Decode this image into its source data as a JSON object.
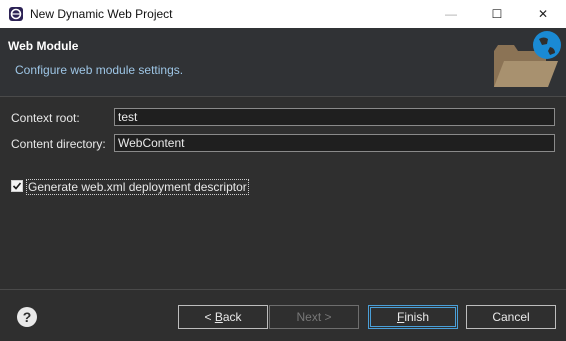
{
  "window": {
    "title": "New Dynamic Web Project",
    "controls": {
      "minimize": "—",
      "maximize": "☐",
      "close": "✕"
    }
  },
  "banner": {
    "title": "Web Module",
    "description": "Configure web module settings."
  },
  "form": {
    "context_root": {
      "label": "Context root:",
      "value": "test"
    },
    "content_directory": {
      "label": "Content directory:",
      "value": "WebContent"
    },
    "generate_web_xml": {
      "label": "Generate web.xml deployment descriptor",
      "checked": true
    }
  },
  "footer": {
    "help": "?",
    "back": {
      "mnemonic_prefix": "< ",
      "mnemonic": "B",
      "rest": "ack"
    },
    "next": "Next >",
    "finish": {
      "mnemonic": "F",
      "rest": "inish"
    },
    "cancel": "Cancel"
  },
  "colors": {
    "background": "#2f2f2f",
    "banner_desc": "#9ec6e6",
    "default_button_border": "#4a9fd8",
    "folder": "#8b7355",
    "globe": "#1a8ad4"
  },
  "icons": [
    "eclipse-app-icon",
    "help-icon",
    "folder-globe-wizard-graphic",
    "checkmark-icon"
  ]
}
